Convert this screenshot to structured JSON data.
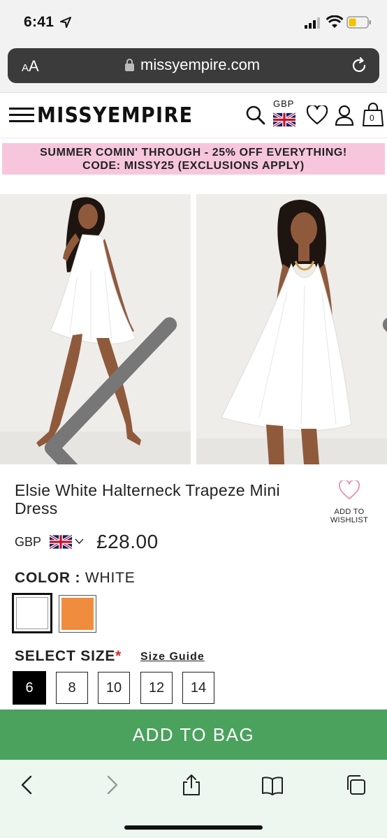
{
  "status": {
    "time": "6:41"
  },
  "browser": {
    "aa_label_small": "A",
    "aa_label_large": "A",
    "url": "missyempire.com"
  },
  "header": {
    "logo": "MISSYEMPIRE",
    "currency": "GBP",
    "bag_count": "0"
  },
  "promo": {
    "line1": "SUMMER COMIN' THROUGH - 25% OFF EVERYTHING!",
    "line2": "CODE: MISSY25 (EXCLUSIONS APPLY)"
  },
  "product": {
    "title": "Elsie White Halterneck Trapeze Mini Dress",
    "wishlist_line1": "ADD TO",
    "wishlist_line2": "WISHLIST",
    "currency": "GBP",
    "price": "£28.00",
    "color_label": "COLOR :",
    "color_value": "WHITE",
    "colors": [
      "#ffffff",
      "#f08c3d"
    ],
    "size_label": "SELECT SIZE",
    "size_required": "*",
    "size_guide": "Size Guide",
    "sizes": [
      "6",
      "8",
      "10",
      "12",
      "14"
    ],
    "selected_size": "6",
    "add_to_bag": "ADD TO BAG"
  },
  "colors": {
    "promo_bg": "#f7c6dd",
    "add_to_bag_bg": "#4aa25d",
    "accent_pink": "#e48fb0"
  }
}
